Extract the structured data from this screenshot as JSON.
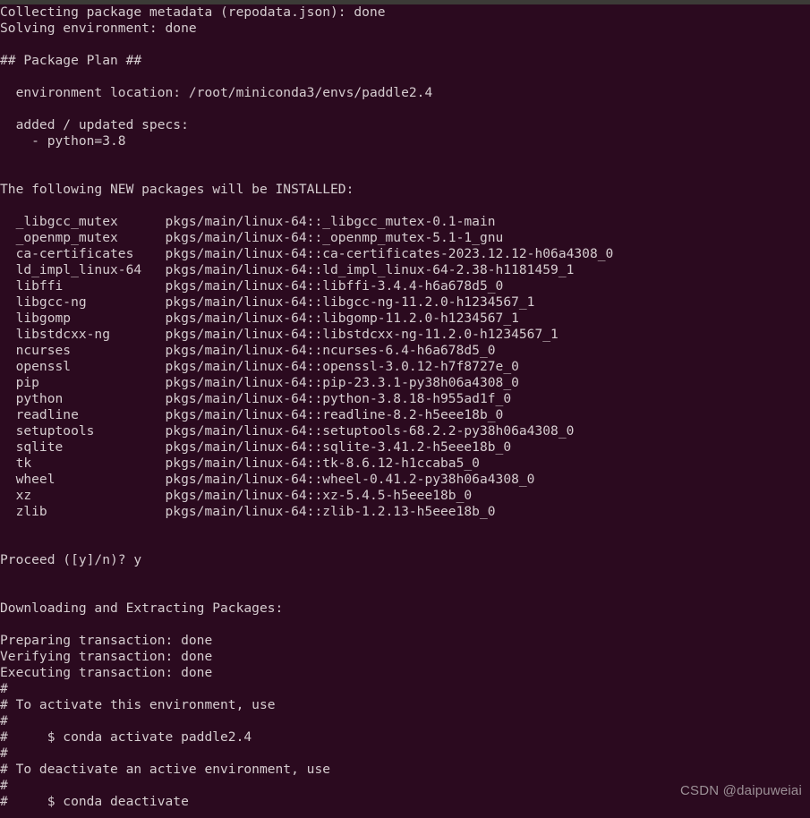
{
  "window": {
    "kind": "terminal",
    "title_bar_color": "#3c3b37",
    "background_color": "#2b0a1f",
    "foreground_color": "#d6cdd0"
  },
  "terminal": {
    "lines": [
      "Collecting package metadata (repodata.json): done",
      "Solving environment: done",
      "",
      "## Package Plan ##",
      "",
      "  environment location: /root/miniconda3/envs/paddle2.4",
      "",
      "  added / updated specs:",
      "    - python=3.8",
      "",
      "",
      "The following NEW packages will be INSTALLED:",
      "",
      "  _libgcc_mutex      pkgs/main/linux-64::_libgcc_mutex-0.1-main",
      "  _openmp_mutex      pkgs/main/linux-64::_openmp_mutex-5.1-1_gnu",
      "  ca-certificates    pkgs/main/linux-64::ca-certificates-2023.12.12-h06a4308_0",
      "  ld_impl_linux-64   pkgs/main/linux-64::ld_impl_linux-64-2.38-h1181459_1",
      "  libffi             pkgs/main/linux-64::libffi-3.4.4-h6a678d5_0",
      "  libgcc-ng          pkgs/main/linux-64::libgcc-ng-11.2.0-h1234567_1",
      "  libgomp            pkgs/main/linux-64::libgomp-11.2.0-h1234567_1",
      "  libstdcxx-ng       pkgs/main/linux-64::libstdcxx-ng-11.2.0-h1234567_1",
      "  ncurses            pkgs/main/linux-64::ncurses-6.4-h6a678d5_0",
      "  openssl            pkgs/main/linux-64::openssl-3.0.12-h7f8727e_0",
      "  pip                pkgs/main/linux-64::pip-23.3.1-py38h06a4308_0",
      "  python             pkgs/main/linux-64::python-3.8.18-h955ad1f_0",
      "  readline           pkgs/main/linux-64::readline-8.2-h5eee18b_0",
      "  setuptools         pkgs/main/linux-64::setuptools-68.2.2-py38h06a4308_0",
      "  sqlite             pkgs/main/linux-64::sqlite-3.41.2-h5eee18b_0",
      "  tk                 pkgs/main/linux-64::tk-8.6.12-h1ccaba5_0",
      "  wheel              pkgs/main/linux-64::wheel-0.41.2-py38h06a4308_0",
      "  xz                 pkgs/main/linux-64::xz-5.4.5-h5eee18b_0",
      "  zlib               pkgs/main/linux-64::zlib-1.2.13-h5eee18b_0",
      "",
      "",
      "Proceed ([y]/n)? y",
      "",
      "",
      "Downloading and Extracting Packages:",
      "",
      "Preparing transaction: done",
      "Verifying transaction: done",
      "Executing transaction: done",
      "#",
      "# To activate this environment, use",
      "#",
      "#     $ conda activate paddle2.4",
      "#",
      "# To deactivate an active environment, use",
      "#",
      "#     $ conda deactivate"
    ]
  },
  "watermark": {
    "text": "CSDN @daipuweiai",
    "color": "#9c9096"
  }
}
